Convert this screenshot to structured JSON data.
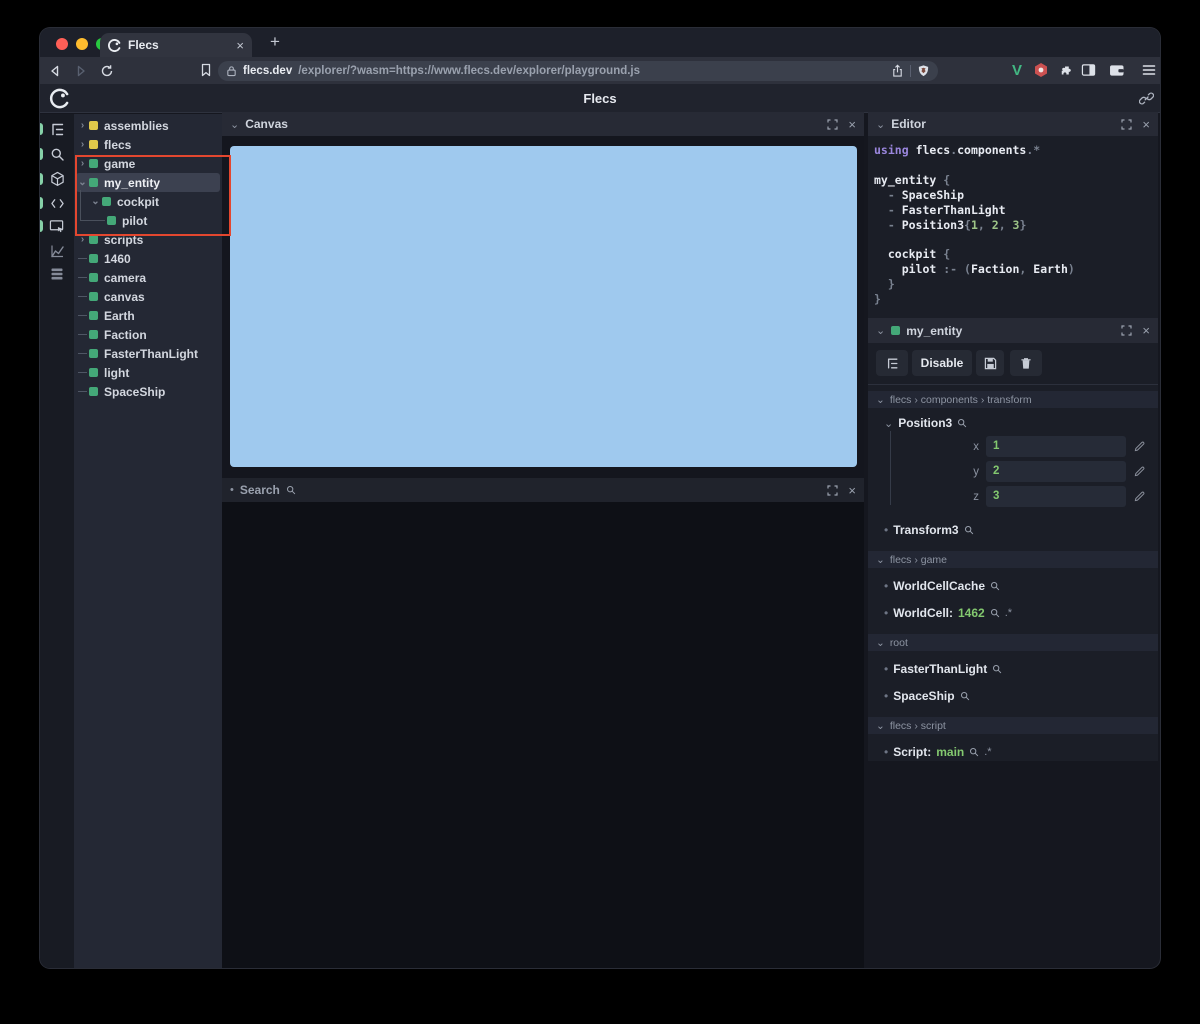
{
  "glyphs": {
    "chev_down": "⌄",
    "chev_right": "›",
    "bullet": "•",
    "close": "×",
    "pair": ".*",
    "new_tab": "+"
  },
  "browser": {
    "tab": {
      "title": "Flecs"
    },
    "url": {
      "domain": "flecs.dev",
      "path": "/explorer/?wasm=https://www.flecs.dev/explorer/playground.js"
    }
  },
  "app_header": {
    "title": "Flecs"
  },
  "tree": {
    "items": [
      {
        "chevron": "›",
        "label": "assemblies"
      },
      {
        "chevron": "›",
        "label": "flecs"
      },
      {
        "chevron": "›",
        "label": "game"
      },
      {
        "chevron": "⌄",
        "label": "my_entity"
      },
      {
        "chevron": "⌄",
        "label": "cockpit"
      },
      {
        "chevron": "",
        "label": "pilot"
      },
      {
        "chevron": "›",
        "label": "scripts"
      },
      {
        "chevron": "",
        "label": "1460"
      },
      {
        "chevron": "",
        "label": "camera"
      },
      {
        "chevron": "",
        "label": "canvas"
      },
      {
        "chevron": "",
        "label": "Earth"
      },
      {
        "chevron": "",
        "label": "Faction"
      },
      {
        "chevron": "",
        "label": "FasterThanLight"
      },
      {
        "chevron": "",
        "label": "light"
      },
      {
        "chevron": "",
        "label": "SpaceShip"
      }
    ]
  },
  "canvas_panel": {
    "title": "Canvas"
  },
  "search_panel": {
    "title": "Search"
  },
  "editor_panel": {
    "title": "Editor",
    "lines": [
      [
        {
          "c": "kw",
          "t": "using"
        },
        {
          "c": "pu",
          "t": " "
        },
        {
          "c": "id",
          "t": "flecs"
        },
        {
          "c": "pu",
          "t": "."
        },
        {
          "c": "id",
          "t": "components"
        },
        {
          "c": "pu",
          "t": ".*"
        }
      ],
      [],
      [
        {
          "c": "id",
          "t": "my_entity"
        },
        {
          "c": "pu",
          "t": " {"
        }
      ],
      [
        {
          "c": "pu",
          "t": "  - "
        },
        {
          "c": "id",
          "t": "SpaceShip"
        }
      ],
      [
        {
          "c": "pu",
          "t": "  - "
        },
        {
          "c": "id",
          "t": "FasterThanLight"
        }
      ],
      [
        {
          "c": "pu",
          "t": "  - "
        },
        {
          "c": "id",
          "t": "Position3"
        },
        {
          "c": "pu",
          "t": "{"
        },
        {
          "c": "nu",
          "t": "1"
        },
        {
          "c": "pu",
          "t": ", "
        },
        {
          "c": "nu",
          "t": "2"
        },
        {
          "c": "pu",
          "t": ", "
        },
        {
          "c": "nu",
          "t": "3"
        },
        {
          "c": "pu",
          "t": "}"
        }
      ],
      [],
      [
        {
          "c": "id",
          "t": "  cockpit"
        },
        {
          "c": "pu",
          "t": " {"
        }
      ],
      [
        {
          "c": "id",
          "t": "    pilot"
        },
        {
          "c": "pu",
          "t": " :- ("
        },
        {
          "c": "id",
          "t": "Faction"
        },
        {
          "c": "pu",
          "t": ", "
        },
        {
          "c": "id",
          "t": "Earth"
        },
        {
          "c": "pu",
          "t": ")"
        }
      ],
      [
        {
          "c": "pu",
          "t": "  }"
        }
      ],
      [
        {
          "c": "pu",
          "t": "}"
        }
      ]
    ]
  },
  "inspector": {
    "title": "my_entity",
    "toolbar": {
      "disable": "Disable"
    },
    "transform": {
      "path": "flecs › components › transform",
      "component": "Position3",
      "fields": [
        {
          "label": "x",
          "value": "1"
        },
        {
          "label": "y",
          "value": "2"
        },
        {
          "label": "z",
          "value": "3"
        }
      ],
      "extra": "Transform3"
    },
    "game": {
      "path": "flecs › game",
      "item1": "WorldCellCache",
      "item2_label": "WorldCell:",
      "item2_value": "1462"
    },
    "root": {
      "path": "root",
      "item1": "FasterThanLight",
      "item2": "SpaceShip"
    },
    "script": {
      "path": "flecs › script",
      "item_label": "Script:",
      "item_value": "main"
    }
  },
  "colors": {
    "canvas_blue": "#9fc9ee",
    "entity_green": "#44a878",
    "module_yellow": "#dfc84a",
    "annotation_red": "#e4472f",
    "value_green": "#83c86f",
    "keyword_purple": "#9a86dd",
    "panel_pill_green": "#86d1a8"
  }
}
